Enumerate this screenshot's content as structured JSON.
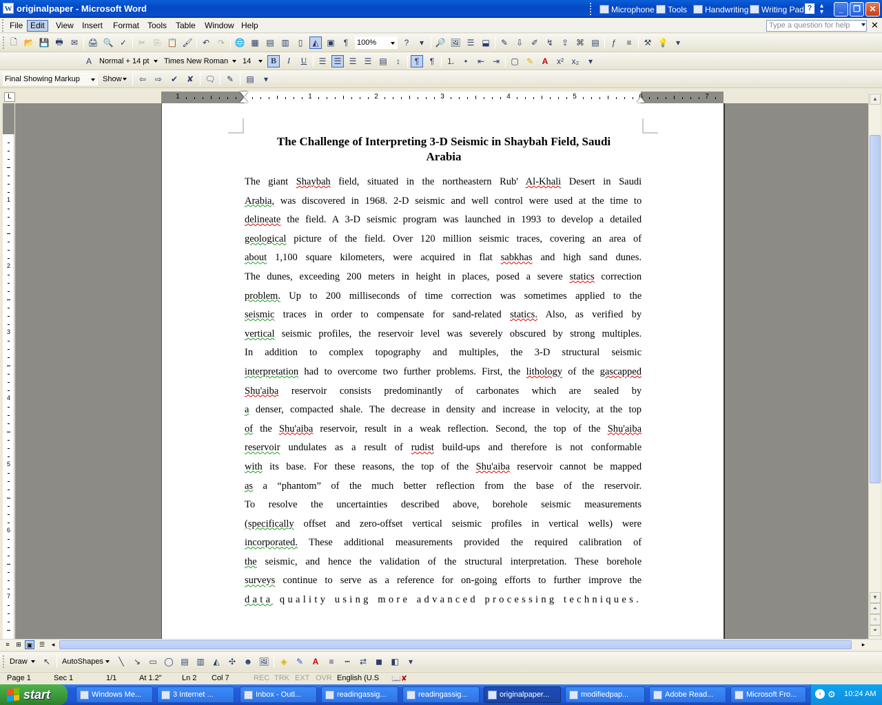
{
  "window": {
    "title": "originalpaper - Microsoft Word"
  },
  "language_bar": {
    "items": [
      "Microphone",
      "Tools",
      "Handwriting",
      "Writing Pad"
    ]
  },
  "menu": {
    "items": [
      "File",
      "Edit",
      "View",
      "Insert",
      "Format",
      "Tools",
      "Table",
      "Window",
      "Help"
    ],
    "active": "Edit",
    "help_placeholder": "Type a question for help"
  },
  "standard_toolbar": {
    "zoom": "100%"
  },
  "formatting_toolbar": {
    "style": "Normal + 14 pt",
    "font": "Times New Roman",
    "size": "14"
  },
  "reviewing_toolbar": {
    "display": "Final Showing Markup",
    "show": "Show"
  },
  "ruler": {
    "labels": [
      "1",
      "1",
      "2",
      "3",
      "4",
      "5",
      "6",
      "7"
    ],
    "vlabels": [
      "1",
      "2",
      "3",
      "4",
      "5",
      "6",
      "7"
    ]
  },
  "document": {
    "title": "The Challenge of Interpreting 3-D Seismic in Shaybah Field, Saudi Arabia",
    "lines": [
      "The giant Shaybah field, situated in the northeastern Rub' Al-Khali Desert in Saudi",
      "Arabia, was discovered in 1968. 2-D seismic and well control were used at the time to",
      "delineate the field. A 3-D seismic program was launched in 1993 to develop a detailed",
      "geological picture of the field. Over 120 million seismic traces, covering an area of",
      "about 1,100 square kilometers, were acquired in flat sabkhas and high sand dunes.",
      "The dunes, exceeding 200 meters in height in places, posed a severe statics correction",
      "problem. Up to 200 milliseconds of time correction was sometimes applied to the",
      "seismic traces in order to compensate for sand-related statics. Also, as verified by",
      "vertical seismic profiles, the reservoir level was severely obscured by strong multiples.",
      "In addition to complex topography and multiples, the 3-D structural seismic",
      "interpretation had to overcome two further problems. First, the lithology of the gascapped",
      "Shu'aiba reservoir consists predominantly of carbonates which are sealed by",
      "a denser, compacted shale. The decrease in density and increase in velocity, at the top",
      "of the Shu'aiba reservoir, result in a weak reflection. Second, the top of the Shu'aiba",
      "reservoir undulates as a result of rudist build-ups and therefore is not conformable",
      "with its base. For these reasons, the top of the Shu'aiba reservoir cannot be mapped",
      "as a “phantom” of the much better reflection from the base of the reservoir.",
      "To resolve the uncertainties described above, borehole seismic measurements",
      "(specifically offset and zero-offset vertical seismic profiles in vertical wells) were",
      "incorporated. These additional measurements provided the required calibration of",
      "the seismic, and hence the validation of the structural interpretation. These borehole",
      "surveys continue to serve as a reference for on-going efforts to further improve the",
      "data quality using more advanced processing techniques."
    ]
  },
  "draw_toolbar": {
    "draw": "Draw",
    "autoshapes": "AutoShapes"
  },
  "status": {
    "page": "Page 1",
    "sec": "Sec 1",
    "pages": "1/1",
    "at": "At 1.2\"",
    "ln": "Ln 2",
    "col": "Col 7",
    "rec": "REC",
    "trk": "TRK",
    "ext": "EXT",
    "ovr": "OVR",
    "lang": "English (U.S"
  },
  "taskbar": {
    "start": "start",
    "tasks": [
      "Windows Me...",
      "3 Internet ...",
      "Inbox - Outl...",
      "readingassig...",
      "readingassig...",
      "originalpaper...",
      "modifiedpap...",
      "Adobe Read...",
      "Microsoft Fro..."
    ],
    "active_index": 5,
    "clock": "10:24 AM"
  }
}
